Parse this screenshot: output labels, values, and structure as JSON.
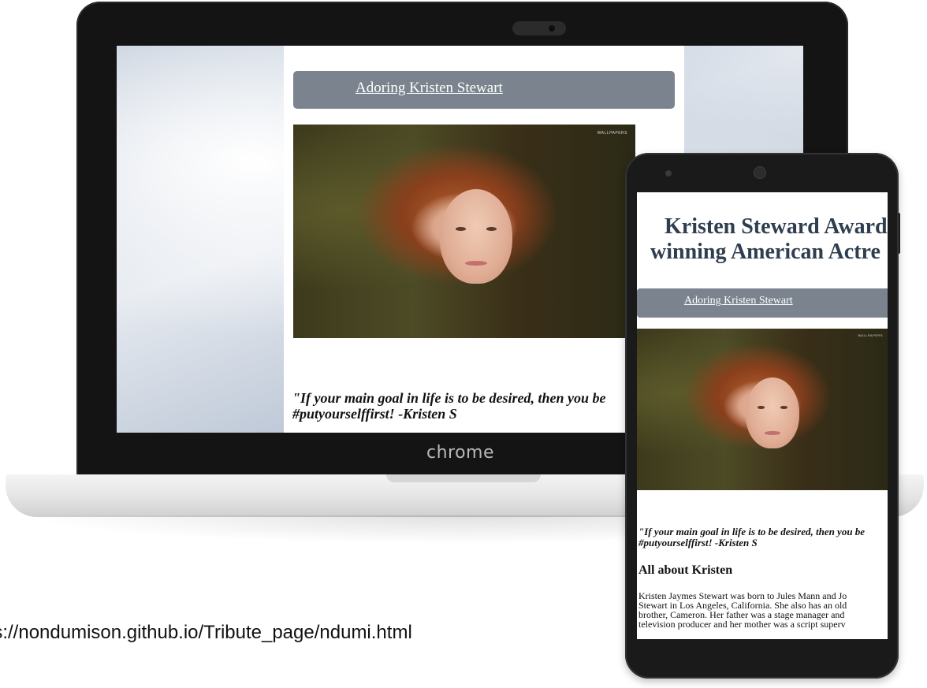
{
  "laptop": {
    "brand_label": "chrome",
    "page": {
      "nav_link": "Adoring Kristen Stewart",
      "image_watermark": "WALLPAPERS",
      "quote_line1": "\"If your main goal in life is to be desired, then you be",
      "quote_line2": "#putyourselffirst! -Kristen S"
    }
  },
  "url": "ps://nondumison.github.io/Tribute_page/ndumi.html",
  "phone": {
    "page": {
      "title_line1": "Kristen Steward Award",
      "title_line2": "winning American Actre",
      "nav_link": "Adoring Kristen Stewart",
      "image_watermark": "WALLPAPERS",
      "quote_line1": "\"If your main goal in life is to be desired, then you be",
      "quote_line2": "#putyourselffirst! -Kristen S",
      "section_heading": "All about Kristen",
      "bio_lines": [
        "Kristen Jaymes Stewart was born to Jules Mann and Jo",
        "Stewart in Los Angeles, California. She also has an old",
        "brother, Cameron. Her father was a stage manager and",
        "television producer and her mother was a script superv"
      ]
    }
  },
  "colors": {
    "nav_bg": "#7b848e",
    "title_color": "#2f3e4e",
    "device_frame": "#141414"
  }
}
